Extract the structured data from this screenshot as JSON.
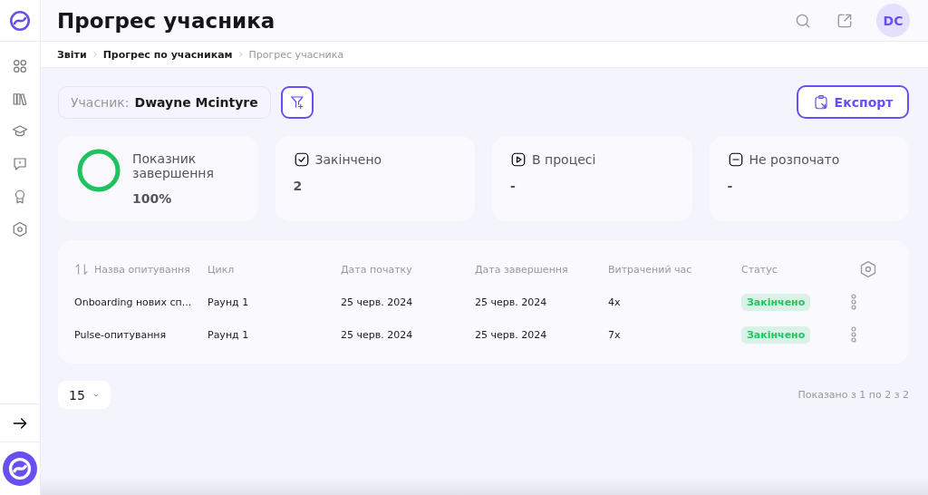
{
  "header": {
    "title": "Прогрес учасника",
    "avatar": "DC"
  },
  "breadcrumbs": [
    {
      "label": "Звіти",
      "current": false
    },
    {
      "label": "Прогрес по учасникам",
      "current": false
    },
    {
      "label": "Прогрес учасника",
      "current": true
    }
  ],
  "participant": {
    "label": "Учасник:",
    "value": "Dwayne Mcintyre"
  },
  "export_button": "Експорт",
  "stats": [
    {
      "kind": "ring",
      "label": "Показник завершення",
      "value": "100%",
      "level": 1
    },
    {
      "kind": "check",
      "label": "Закінчено",
      "value": "2"
    },
    {
      "kind": "play",
      "label": "В процесі",
      "value": "-"
    },
    {
      "kind": "minus",
      "label": "Не розпочато",
      "value": "-"
    }
  ],
  "table": {
    "columns": [
      "Назва опитування",
      "Цикл",
      "Дата початку",
      "Дата завершення",
      "Витрачений час",
      "Статус"
    ],
    "rows": [
      {
        "cells": [
          "Onboarding нових сп...",
          "Раунд 1",
          "25 черв. 2024",
          "25 черв. 2024",
          "4х"
        ],
        "status": "Закінчено",
        "color": "#22c55e"
      },
      {
        "cells": [
          "Pulse-опитування",
          "Раунд 1",
          "25 черв. 2024",
          "25 черв. 2024",
          "7х"
        ],
        "status": "Закінчено",
        "color": "#22c55e"
      }
    ]
  },
  "pagination": {
    "page_size": "15",
    "summary": "Показано з 1 по 2 з 2"
  }
}
